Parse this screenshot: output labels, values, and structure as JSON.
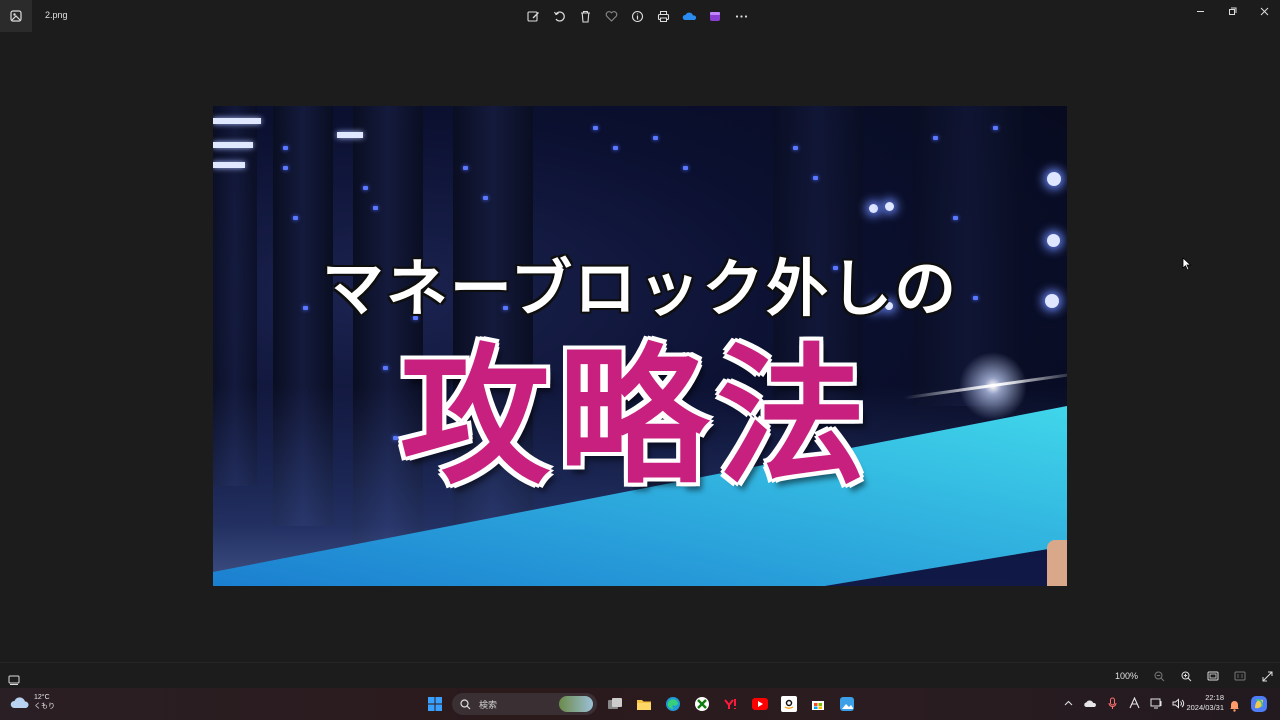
{
  "window": {
    "file_name": "2.png",
    "toolbar_icons": [
      "edit-icon",
      "rotate-icon",
      "delete-icon",
      "favorite-icon",
      "info-icon",
      "print-icon",
      "onedrive-icon",
      "clipchamp-icon",
      "more-icon"
    ],
    "controls": [
      "minimize-icon",
      "maximize-icon",
      "close-icon"
    ]
  },
  "image": {
    "headline": "マネーブロック外しの",
    "title": "攻略法",
    "colors": {
      "title": "#c8207e",
      "banner_start": "#1b7fd0",
      "banner_end": "#40d6ea"
    }
  },
  "statusbar": {
    "zoom": "100%",
    "icons": [
      "filmstrip-icon",
      "zoom-out-icon",
      "zoom-in-icon",
      "fit-icon",
      "actual-size-icon",
      "fullscreen-icon"
    ]
  },
  "taskbar": {
    "weather": {
      "temp": "12°C",
      "condition": "くもり"
    },
    "search_placeholder": "検索",
    "apps": [
      "windows-start-icon",
      "task-view-icon",
      "file-explorer-icon",
      "edge-icon",
      "xbox-icon",
      "yahoo-icon",
      "youtube-icon",
      "amazon-icon",
      "store-icon",
      "photos-icon"
    ],
    "clock": {
      "time": "22:18",
      "date": "2024/03/31"
    }
  }
}
